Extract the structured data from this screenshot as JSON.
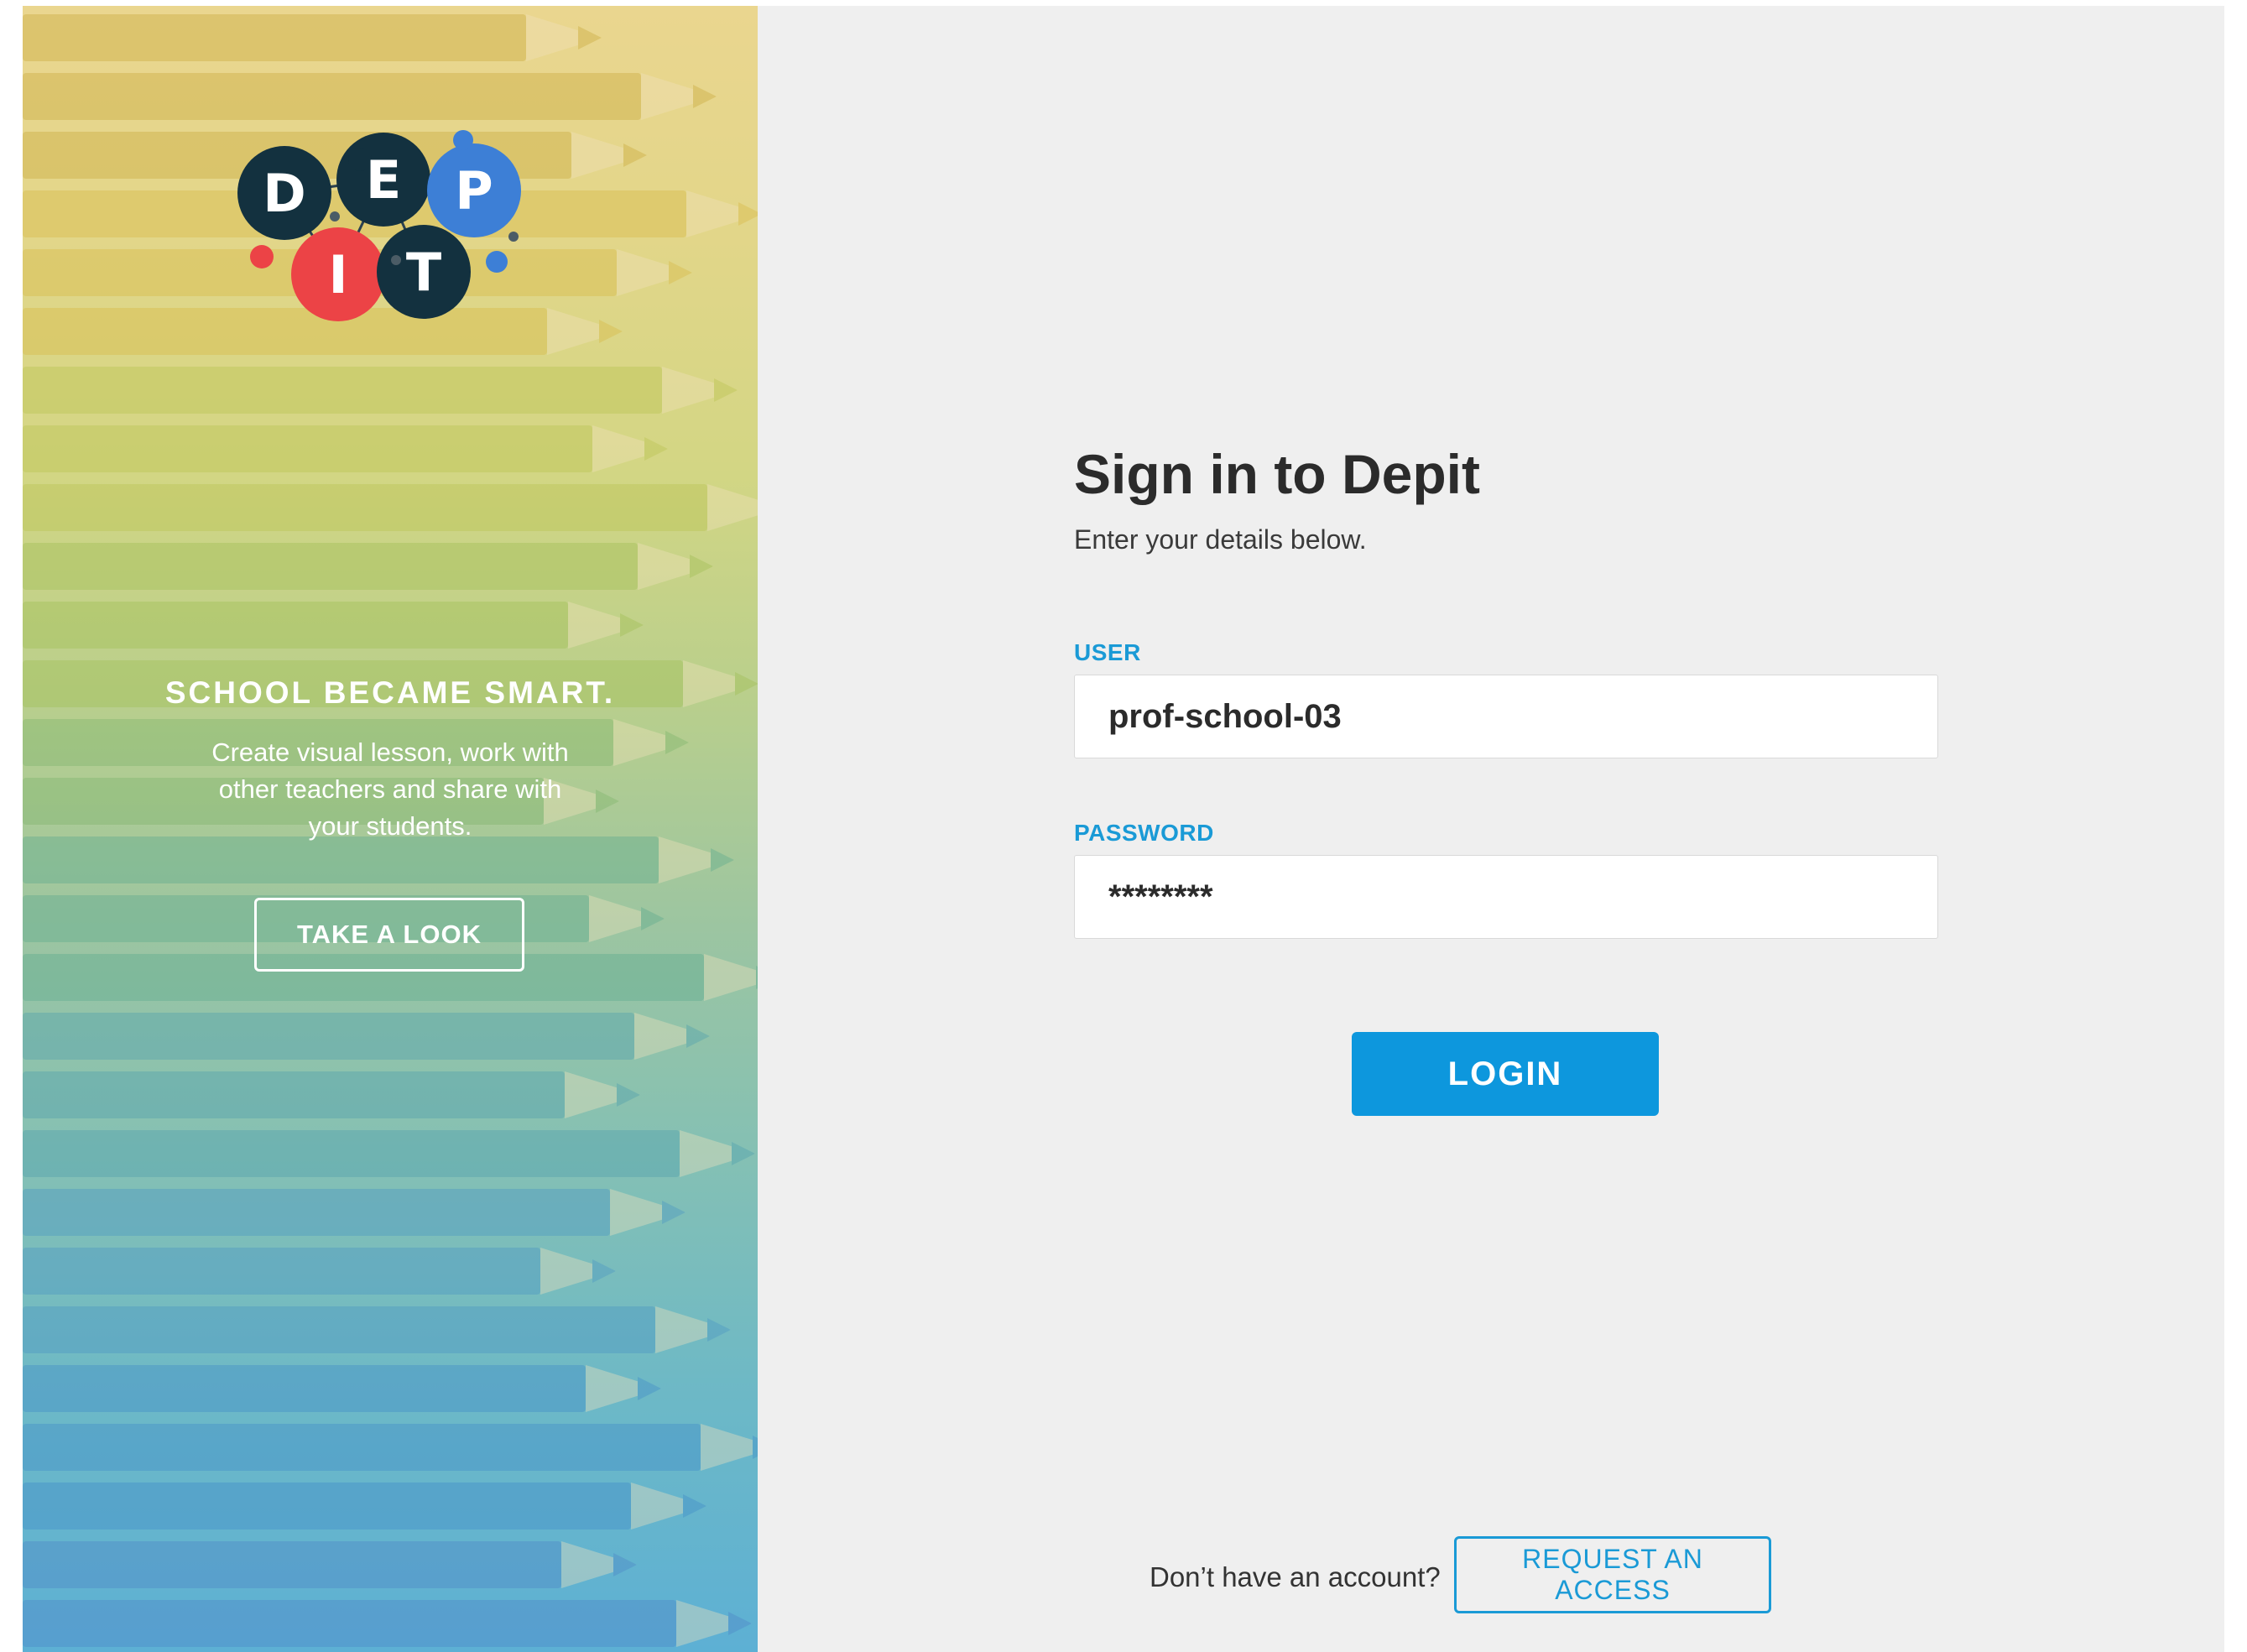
{
  "brand": {
    "logo_letters": [
      "D",
      "E",
      "P",
      "I",
      "T"
    ],
    "colors": {
      "dark": "#13313f",
      "blue": "#3d7fd6",
      "red": "#ec4346",
      "accent": "#1a9ad6",
      "button": "#0d97dd"
    }
  },
  "hero": {
    "headline": "SCHOOL BECAME SMART.",
    "body_lines": [
      "Create visual lesson, work with",
      "other teachers and share with",
      "your students."
    ],
    "cta_label": "TAKE A LOOK"
  },
  "form": {
    "title": "Sign in to Depit",
    "subtitle": "Enter your details below.",
    "user_label": "USER",
    "user_value": "prof-school-03",
    "password_label": "PASSWORD",
    "password_value": "********",
    "login_label": "LOGIN"
  },
  "footer": {
    "question": "Don’t have an account?",
    "request_label": "REQUEST AN ACCESS"
  }
}
